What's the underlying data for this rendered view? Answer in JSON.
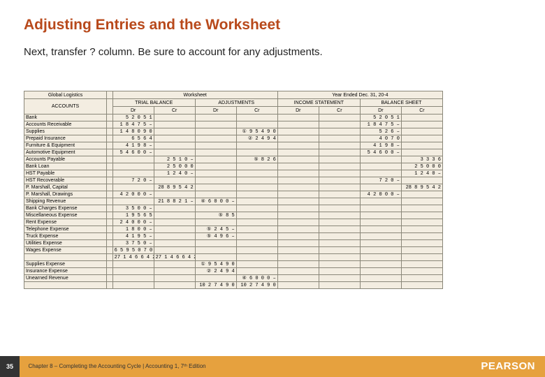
{
  "title": "Adjusting Entries and the Worksheet",
  "subtitle": "Next, transfer ? column. Be sure to account for any adjustments.",
  "sheet_header": {
    "company": "Global Logistics",
    "sheet_title": "Worksheet",
    "period": "Year Ended Dec. 31, 20-4"
  },
  "col_groups": [
    "TRIAL BALANCE",
    "ADJUSTMENTS",
    "INCOME STATEMENT",
    "BALANCE SHEET"
  ],
  "col_pair": {
    "dr": "Dr",
    "cr": "Cr"
  },
  "accounts_label": "ACCOUNTS",
  "rows": [
    {
      "acct": "Bank",
      "tb_dr": "5 2 0 5 1",
      "bs_dr": "5 2 0 5 1"
    },
    {
      "acct": "Accounts Receivable",
      "tb_dr": "1 8 4 7 5 –",
      "bs_dr": "1 8 4 7 5 –"
    },
    {
      "acct": "Supplies",
      "tb_dr": "1 4 8 0 9 0",
      "adj_cr": "① 9 5 4 9 0",
      "bs_dr": "5 2 6 –"
    },
    {
      "acct": "Prepaid Insurance",
      "tb_dr": "6 5 6 4",
      "adj_cr": "② 2 4 9 4",
      "bs_dr": "4 0 7 0"
    },
    {
      "acct": "Furniture & Equipment",
      "tb_dr": "4 1 9 8 –",
      "bs_dr": "4 1 9 8 –"
    },
    {
      "acct": "Automotive Equipment",
      "tb_dr": "5 4 6 0 0 –",
      "bs_dr": "5 4 6 0 0 –"
    },
    {
      "acct": "Accounts Payable",
      "tb_cr": "2 5 1 0 –",
      "adj_cr": "⑤ 8 2 6",
      "bs_cr": "3 3 3 6"
    },
    {
      "acct": "Bank Loan",
      "tb_cr": "2 5 0 0 0",
      "bs_cr": "2 5 0 0 0"
    },
    {
      "acct": "HST Payable",
      "tb_cr": "1 2 4 0 –",
      "bs_cr": "1 2 4 0 –"
    },
    {
      "acct": "HST Recoverable",
      "tb_dr": "7 2 0 –",
      "bs_dr": "7 2 0 –"
    },
    {
      "acct": "P. Marshall, Capital",
      "tb_cr": "28 8 9 5 4 2",
      "bs_cr": "28 8 9 5 4 2"
    },
    {
      "acct": "P. Marshall, Drawings",
      "tb_dr": "4 2 0 0 0 –",
      "bs_dr": "4 2 0 0 0 –"
    },
    {
      "acct": "Shipping Revenue",
      "tb_cr": "21 8 8 2 1 –",
      "adj_dr": "④ 6 0 0 0 –"
    },
    {
      "acct": "Bank Charges Expense",
      "tb_dr": "3 5 0 0 –"
    },
    {
      "acct": "Miscellaneous Expense",
      "tb_dr": "1 9 5 6 5",
      "adj_dr": "⑤ 8 5"
    },
    {
      "acct": "Rent Expense",
      "tb_dr": "2 4 0 0 0 –"
    },
    {
      "acct": "Telephone Expense",
      "tb_dr": "1 8 0 0 –",
      "adj_dr": "⑤ 2 4 5 –"
    },
    {
      "acct": "Truck Expense",
      "tb_dr": "4 1 9 5 –",
      "adj_dr": "⑤ 4 9 6 –"
    },
    {
      "acct": "Utilities Expense",
      "tb_dr": "3 7 5 0 –"
    },
    {
      "acct": "Wages Expense",
      "tb_dr": "6 5 9 5 0 7 0"
    },
    {
      "acct": "",
      "tb_dr": "27 1 4 6 6 4 2",
      "tb_cr": "27 1 4 6 6 4 2"
    },
    {
      "acct": "Supplies Expense",
      "adj_dr": "① 9 5 4 9 0"
    },
    {
      "acct": "Insurance Expense",
      "adj_dr": "② 2 4 9 4"
    },
    {
      "acct": "Unearned Revenue",
      "adj_cr": "④ 6 0 0 0 –"
    },
    {
      "acct": "",
      "adj_dr": "10 2 7 4 9 0",
      "adj_cr": "10 2 7 4 9 0"
    }
  ],
  "footer": {
    "page": "35",
    "chapter": "Chapter 8 – Completing the Accounting Cycle | Accounting 1, 7ᵗʰ Edition",
    "logo": "PEARSON"
  }
}
